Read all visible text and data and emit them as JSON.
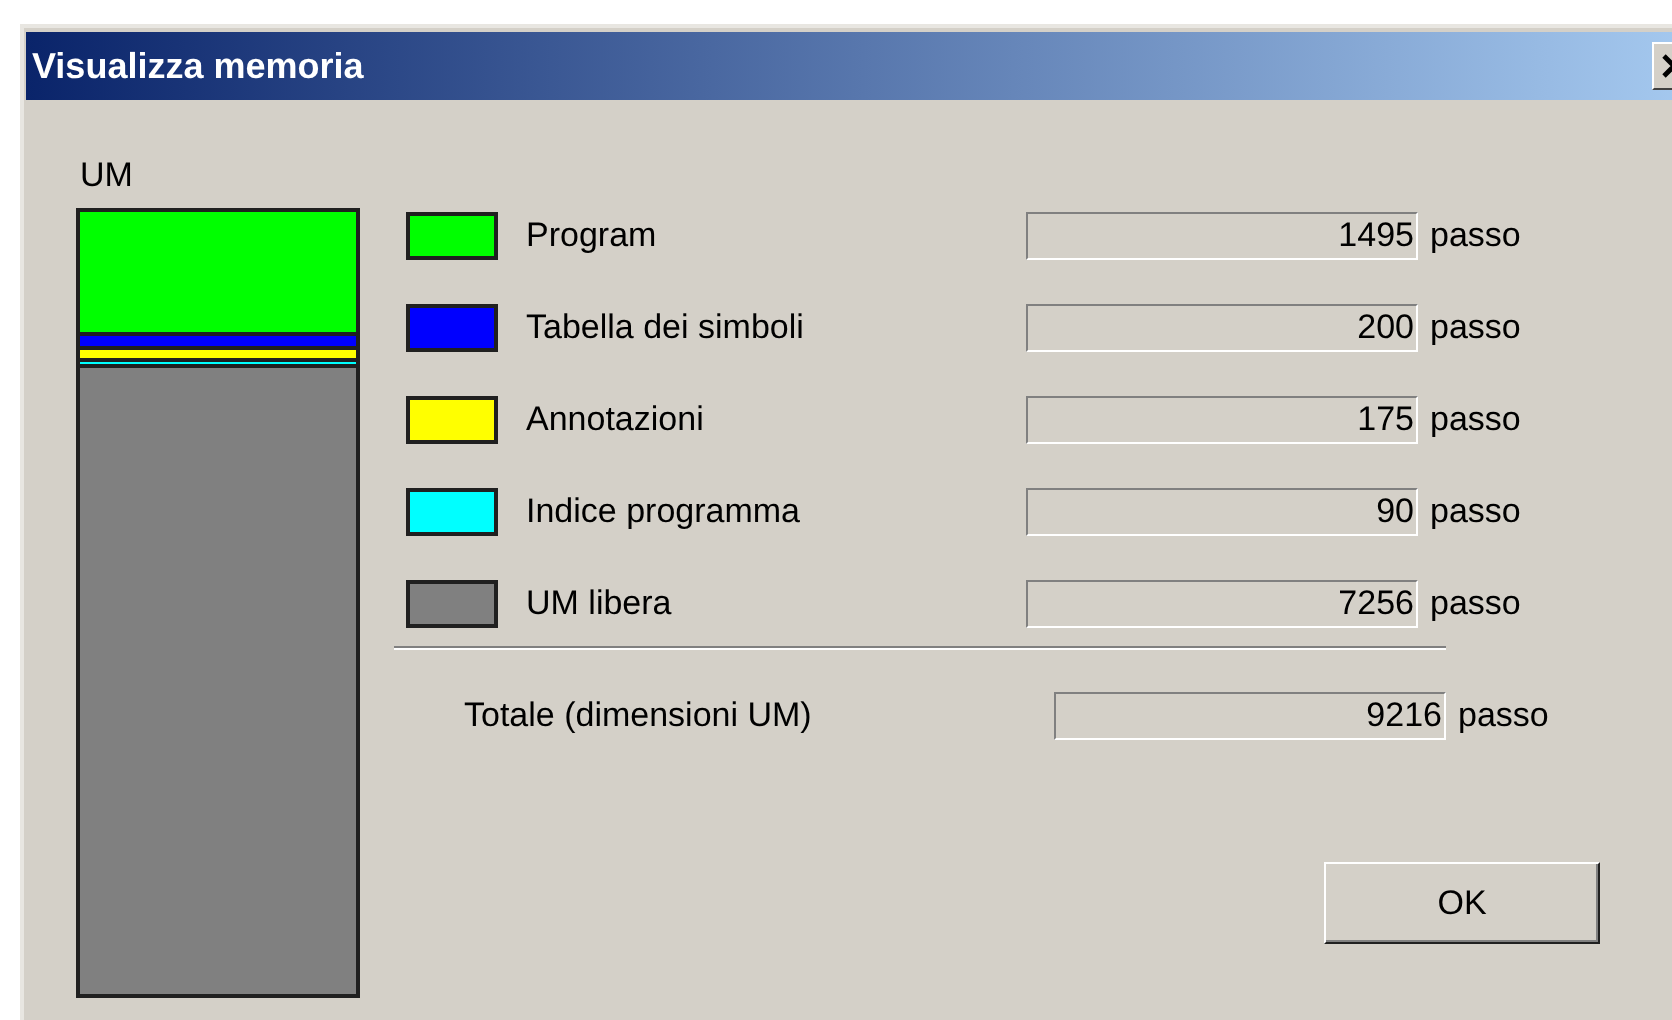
{
  "window": {
    "title": "Visualizza memoria"
  },
  "memory_bar": {
    "label": "UM"
  },
  "items": [
    {
      "label": "Program",
      "color": "#00ff00",
      "value": "1495",
      "unit": "passo"
    },
    {
      "label": "Tabella dei simboli",
      "color": "#0000ff",
      "value": "200",
      "unit": "passo"
    },
    {
      "label": "Annotazioni",
      "color": "#ffff00",
      "value": "175",
      "unit": "passo"
    },
    {
      "label": "Indice programma",
      "color": "#00ffff",
      "value": "90",
      "unit": "passo"
    },
    {
      "label": "UM libera",
      "color": "#808080",
      "value": "7256",
      "unit": "passo"
    }
  ],
  "total": {
    "label": "Totale (dimensioni UM)",
    "value": "9216",
    "unit": "passo"
  },
  "buttons": [
    "OK"
  ]
}
